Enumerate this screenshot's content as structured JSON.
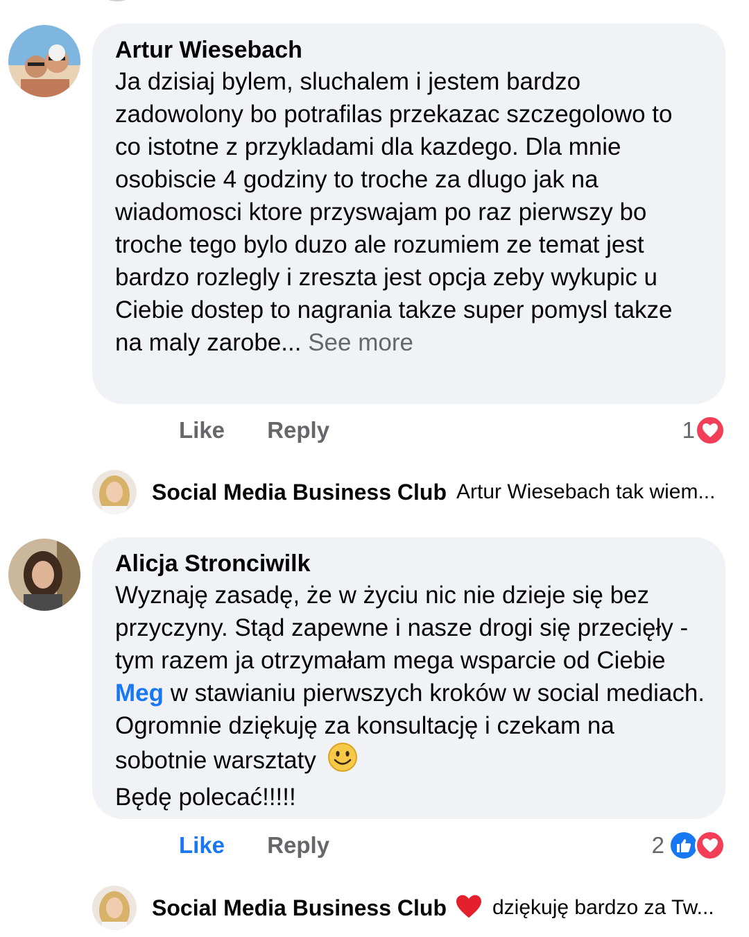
{
  "comments": [
    {
      "author": "Artur Wiesebach",
      "text": "Ja dzisiaj bylem, sluchalem i jestem bardzo zadowolony bo potrafilas przekazac szczegolowo to co istotne z przykladami dla kazdego. Dla mnie osobiscie 4 godziny to troche za dlugo jak na wiadomosci ktore przyswajam po raz pierwszy bo troche tego bylo duzo ale rozumiem ze temat jest bardzo rozlegly i zreszta jest opcja zeby wykupic u Ciebie dostep to nagrania takze super pomysl takze na maly zarobe...",
      "see_more": "See more",
      "like_label": "Like",
      "reply_label": "Reply",
      "reaction_count": "1",
      "reactions": [
        "love-icon"
      ],
      "reply": {
        "author": "Social Media Business Club",
        "text": "Artur Wiesebach tak wiem..."
      }
    },
    {
      "author": "Alicja Stronciwilk",
      "text_part1": "Wyznaję zasadę, że w życiu nic nie dzieje się bez przyczyny. Stąd zapewne i nasze drogi się przecięły - tym razem ja otrzymałam mega wsparcie od Ciebie",
      "mention": "Meg",
      "text_part2": " w stawianiu pierwszych kroków w social mediach. Ogromnie dziękuję za konsultację i czekam na sobotnie warsztaty",
      "text_part3": "Będę polecać!!!!!",
      "like_label": "Like",
      "reply_label": "Reply",
      "reaction_count": "2",
      "reactions": [
        "like-icon",
        "love-icon"
      ],
      "liked": true,
      "reply": {
        "author": "Social Media Business Club",
        "text": "dziękuję bardzo za Tw..."
      }
    }
  ],
  "colors": {
    "bubble": "#f0f2f5",
    "secondary_text": "#65676b",
    "accent_blue": "#1877f2",
    "love_red": "#f33e58"
  }
}
